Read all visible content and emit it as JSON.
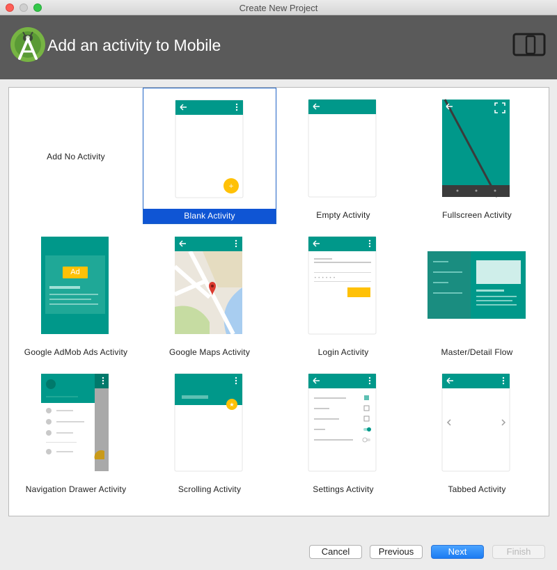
{
  "window": {
    "title": "Create New Project"
  },
  "header": {
    "title": "Add an activity to Mobile"
  },
  "tiles": [
    {
      "label": "Add No Activity"
    },
    {
      "label": "Blank Activity"
    },
    {
      "label": "Empty Activity"
    },
    {
      "label": "Fullscreen Activity"
    },
    {
      "label": "Google AdMob Ads Activity",
      "badge": "Ad"
    },
    {
      "label": "Google Maps Activity"
    },
    {
      "label": "Login Activity"
    },
    {
      "label": "Master/Detail Flow"
    },
    {
      "label": "Navigation Drawer Activity"
    },
    {
      "label": "Scrolling Activity"
    },
    {
      "label": "Settings Activity"
    },
    {
      "label": "Tabbed Activity"
    }
  ],
  "selected_tile": "Blank Activity",
  "buttons": {
    "cancel": "Cancel",
    "previous": "Previous",
    "next": "Next",
    "finish": "Finish"
  },
  "colors": {
    "teal": "#00988a",
    "dark_teal": "#00796b",
    "accent": "#ffc107",
    "selection": "#0f55d4",
    "header_bg": "#5a5a5a"
  }
}
